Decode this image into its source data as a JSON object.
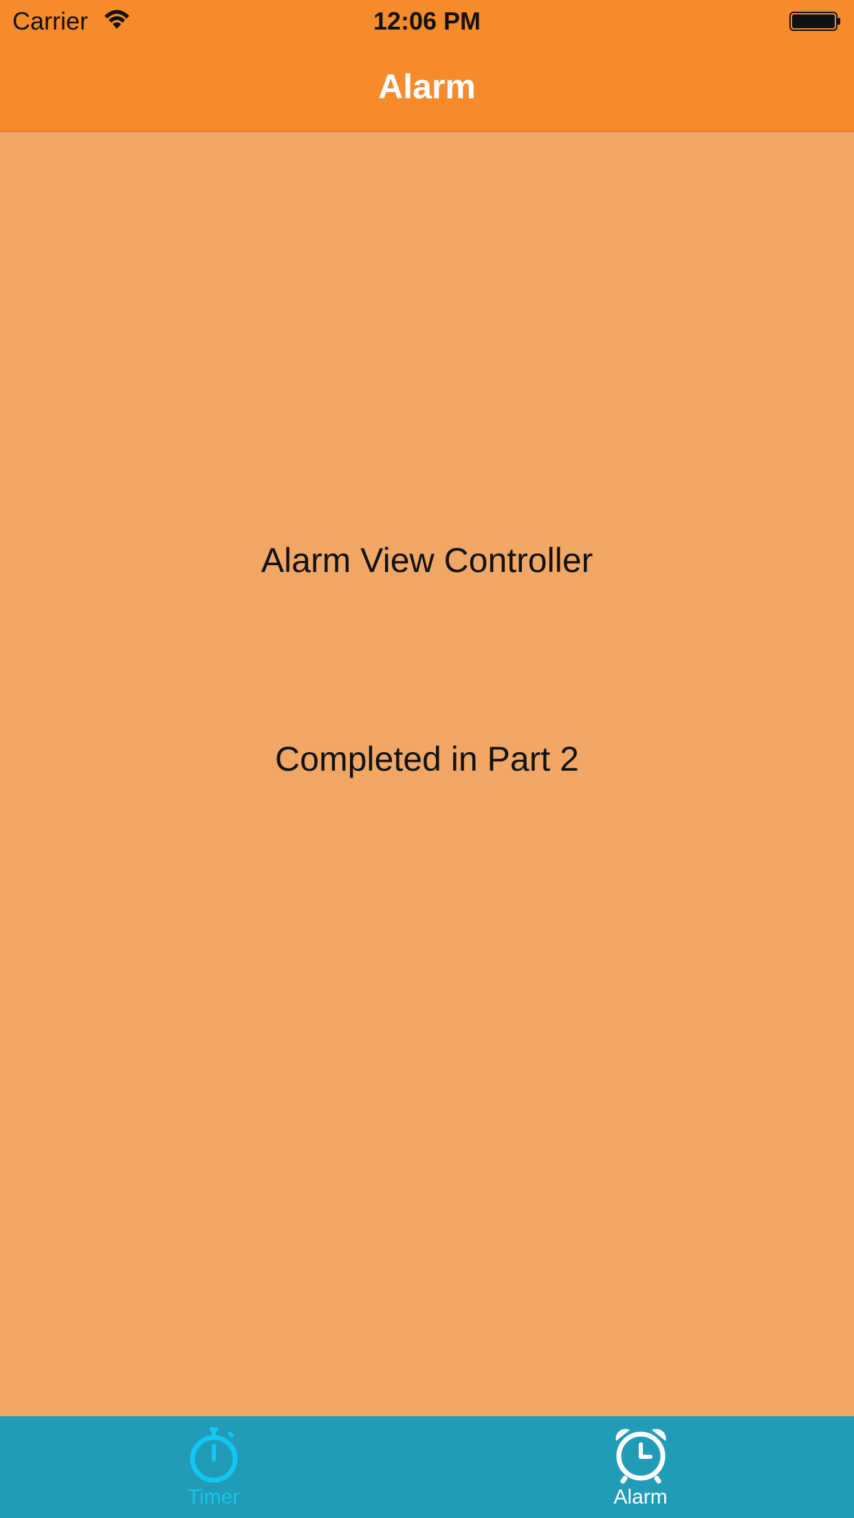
{
  "status_bar": {
    "carrier": "Carrier",
    "time": "12:06 PM",
    "wifi_icon": "wifi-icon",
    "battery_icon": "battery-icon"
  },
  "nav_bar": {
    "title": "Alarm",
    "background_color": "#F68B2C"
  },
  "main": {
    "background_color": "#F0A766",
    "title_label": "Alarm View Controller",
    "subtitle_label": "Completed in Part 2"
  },
  "tab_bar": {
    "background_color": "#219BB8",
    "items": [
      {
        "label": "Timer",
        "icon": "stopwatch-icon",
        "color": "#12C8F2",
        "selected": false
      },
      {
        "label": "Alarm",
        "icon": "alarm-clock-icon",
        "color": "#FFFFFF",
        "selected": true
      }
    ]
  }
}
